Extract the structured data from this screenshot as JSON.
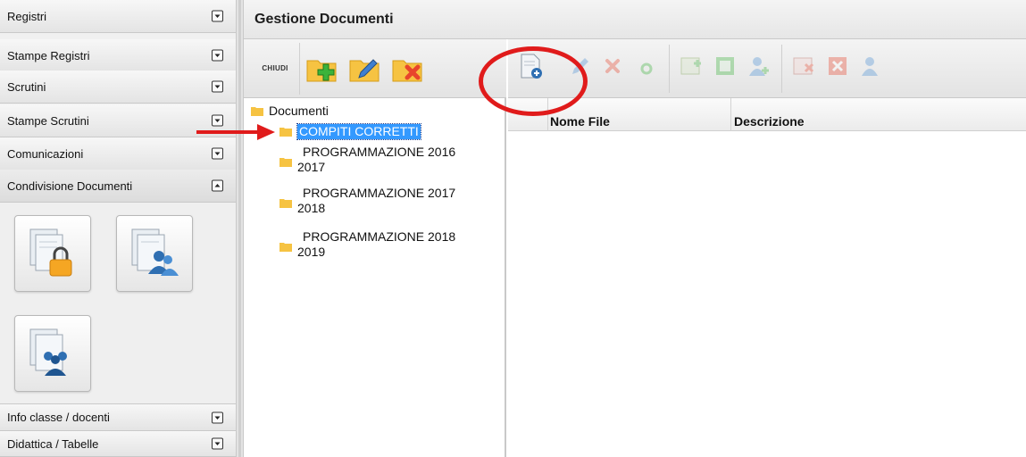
{
  "sidebar": {
    "sections": [
      {
        "label": "Registri"
      },
      {
        "label": "Stampe Registri"
      },
      {
        "label": "Scrutini"
      },
      {
        "label": "Stampe Scrutini"
      },
      {
        "label": "Comunicazioni"
      },
      {
        "label": "Condivisione Documenti"
      },
      {
        "label": "Info classe / docenti"
      },
      {
        "label": "Didattica / Tabelle"
      }
    ],
    "expanded_section": "Condivisione Documenti"
  },
  "main": {
    "title": "Gestione Documenti",
    "tree_toolbar": {
      "close_label": "CHIUDI"
    },
    "tree": {
      "root": "Documenti",
      "folders": [
        {
          "label": "COMPITI CORRETTI",
          "selected": true
        },
        {
          "line1": "PROGRAMMAZIONE 2016",
          "line2": "2017"
        },
        {
          "line1": "PROGRAMMAZIONE 2017",
          "line2": "2018"
        },
        {
          "line1": "PROGRAMMAZIONE 2018",
          "line2": "2019"
        }
      ]
    },
    "grid": {
      "columns": [
        "Nome File",
        "Descrizione"
      ]
    }
  },
  "colors": {
    "selection": "#3399ff",
    "annotation_red": "#e01b1b",
    "folder_yellow": "#f6c342",
    "add_green": "#3bb33b",
    "delete_red": "#e8452c"
  }
}
